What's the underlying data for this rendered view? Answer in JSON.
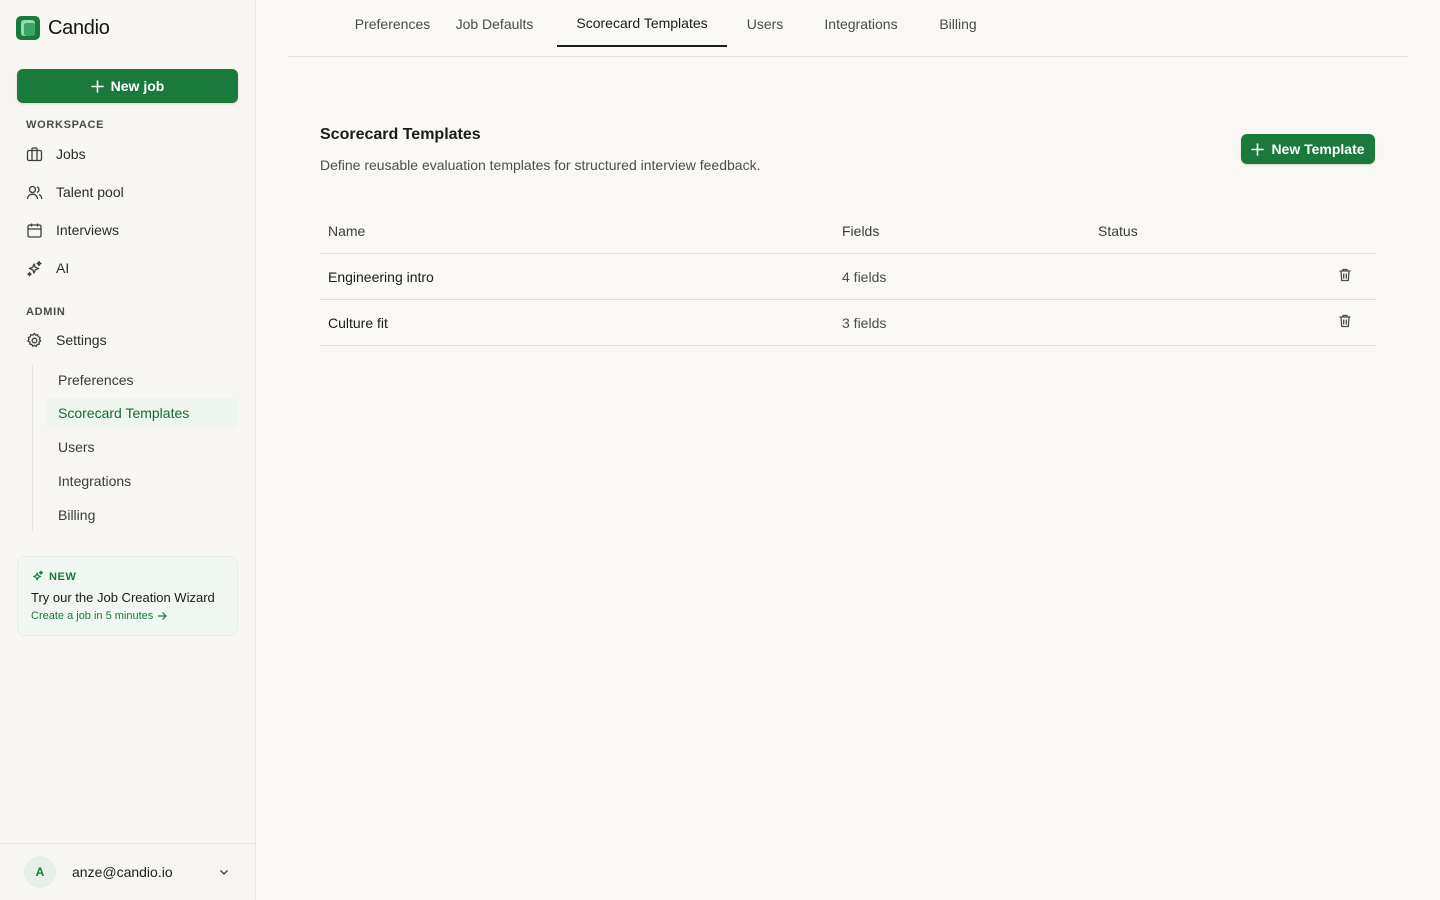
{
  "brand": {
    "name": "Candio",
    "accent": "#1a7a3c"
  },
  "sidebar": {
    "new_job_label": "New job",
    "workspace_label": "WORKSPACE",
    "workspace_items": [
      {
        "label": "Jobs",
        "icon": "briefcase-icon"
      },
      {
        "label": "Talent pool",
        "icon": "users-icon"
      },
      {
        "label": "Interviews",
        "icon": "calendar-icon"
      },
      {
        "label": "AI",
        "icon": "sparkles-icon"
      }
    ],
    "admin_label": "ADMIN",
    "settings_label": "Settings",
    "settings_subitems": [
      {
        "label": "Preferences",
        "active": false
      },
      {
        "label": "Scorecard Templates",
        "active": true
      },
      {
        "label": "Users",
        "active": false
      },
      {
        "label": "Integrations",
        "active": false
      },
      {
        "label": "Billing",
        "active": false
      }
    ],
    "promo": {
      "tag": "NEW",
      "title": "Try our the Job Creation Wizard",
      "subtitle": "Create a job in 5 minutes"
    },
    "user": {
      "initial": "A",
      "email": "anze@candio.io"
    }
  },
  "tabs": [
    {
      "label": "Preferences",
      "active": false
    },
    {
      "label": "Job Defaults",
      "active": false
    },
    {
      "label": "Scorecard Templates",
      "active": true
    },
    {
      "label": "Users",
      "active": false
    },
    {
      "label": "Integrations",
      "active": false
    },
    {
      "label": "Billing",
      "active": false
    }
  ],
  "main": {
    "title": "Scorecard Templates",
    "description": "Define reusable evaluation templates for structured interview feedback.",
    "new_template_label": "New Template",
    "table": {
      "columns": [
        "Name",
        "Fields",
        "Status"
      ],
      "rows": [
        {
          "name": "Engineering intro",
          "fields": "4 fields",
          "status": ""
        },
        {
          "name": "Culture fit",
          "fields": "3 fields",
          "status": ""
        }
      ]
    }
  }
}
